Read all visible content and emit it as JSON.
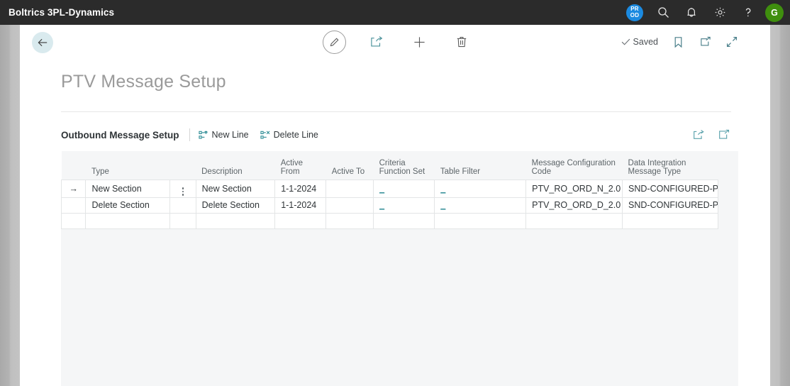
{
  "topbar": {
    "brand": "Boltrics 3PL-Dynamics",
    "env_badge": {
      "line1": "PR",
      "line2": "OD",
      "color": "#1b8ae0"
    },
    "icons": [
      {
        "name": "search-icon",
        "label": "Search"
      },
      {
        "name": "notification-bell-icon",
        "label": "Notifications"
      },
      {
        "name": "gear-icon",
        "label": "Settings"
      },
      {
        "name": "help-question-icon",
        "label": "Help"
      }
    ],
    "avatar": {
      "initial": "G",
      "color": "#3f8f0e"
    }
  },
  "commandbar": {
    "back_label": "Back",
    "edit_label": "Edit",
    "share_label": "Share",
    "new_label": "New",
    "delete_label": "Delete",
    "saved_label": "Saved",
    "bookmark_label": "Bookmark",
    "open_new_window_label": "Open in new window",
    "collapse_label": "Collapse"
  },
  "page": {
    "title": "PTV Message Setup"
  },
  "subheader": {
    "title": "Outbound Message Setup",
    "actions": [
      {
        "name": "new-line-button",
        "label": "New Line"
      },
      {
        "name": "delete-line-button",
        "label": "Delete Line"
      }
    ],
    "right_icons": [
      {
        "name": "share-export-icon",
        "label": "Open in Excel"
      },
      {
        "name": "expand-icon",
        "label": "Expand"
      }
    ]
  },
  "grid": {
    "columns": [
      {
        "key": "selector",
        "label": ""
      },
      {
        "key": "type",
        "label": "Type"
      },
      {
        "key": "menu",
        "label": ""
      },
      {
        "key": "description",
        "label": "Description"
      },
      {
        "key": "active_from",
        "label": "Active From"
      },
      {
        "key": "active_to",
        "label": "Active To"
      },
      {
        "key": "criteria_function_set",
        "label": "Criteria Function Set"
      },
      {
        "key": "table_filter",
        "label": "Table Filter"
      },
      {
        "key": "message_configuration_code",
        "label": "Message Configuration Code"
      },
      {
        "key": "data_integration_message_type",
        "label": "Data Integration Message Type"
      }
    ],
    "rows": [
      {
        "selected": true,
        "selector": "→",
        "type": "New Section",
        "description": "New Section",
        "active_from": "1-1-2024",
        "active_to": "",
        "criteria_function_set": "_",
        "table_filter": "_",
        "message_configuration_code": "PTV_RO_ORD_N_2.0",
        "data_integration_message_type": "SND-CONFIGURED-PTV"
      },
      {
        "selected": false,
        "selector": "",
        "type": "Delete Section",
        "description": "Delete Section",
        "active_from": "1-1-2024",
        "active_to": "",
        "criteria_function_set": "_",
        "table_filter": "_",
        "message_configuration_code": "PTV_RO_ORD_D_2.0",
        "data_integration_message_type": "SND-CONFIGURED-PTV"
      },
      {
        "selected": false,
        "selector": "",
        "type": "",
        "description": "",
        "active_from": "",
        "active_to": "",
        "criteria_function_set": "",
        "table_filter": "",
        "message_configuration_code": "",
        "data_integration_message_type": ""
      }
    ]
  },
  "colors": {
    "accent_teal": "#2c8b94",
    "highlight_cell": "#a9e2e2",
    "topbar_bg": "#2b2b2b",
    "grid_bg": "#f5f6f7"
  }
}
